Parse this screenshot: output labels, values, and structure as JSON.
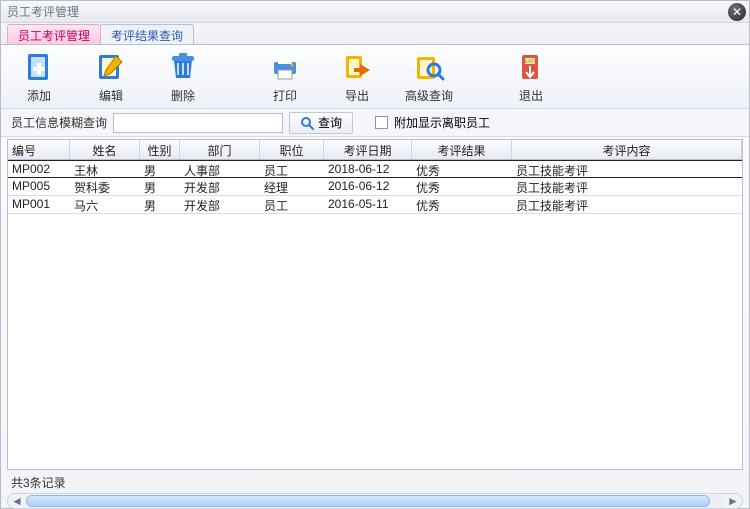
{
  "window": {
    "title": "员工考评管理"
  },
  "tabs": [
    {
      "label": "员工考评管理",
      "active": true
    },
    {
      "label": "考评结果查询",
      "active": false
    }
  ],
  "toolbar": {
    "add": "添加",
    "edit": "编辑",
    "delete": "删除",
    "print": "打印",
    "export": "导出",
    "adv_query": "高级查询",
    "exit": "退出"
  },
  "search": {
    "label": "员工信息模糊查询",
    "value": "",
    "placeholder": "",
    "query_btn": "查询",
    "show_left": "附加显示离职员工",
    "show_left_checked": false
  },
  "columns": [
    "编号",
    "姓名",
    "性别",
    "部门",
    "职位",
    "考评日期",
    "考评结果",
    "考评内容"
  ],
  "rows": [
    {
      "id": "MP002",
      "name": "王林",
      "gender": "男",
      "dept": "人事部",
      "title": "员工",
      "date": "2018-06-12",
      "result": "优秀",
      "content": "员工技能考评",
      "selected": true
    },
    {
      "id": "MP005",
      "name": "贺科委",
      "gender": "男",
      "dept": "开发部",
      "title": "经理",
      "date": "2016-06-12",
      "result": "优秀",
      "content": "员工技能考评",
      "selected": false
    },
    {
      "id": "MP001",
      "name": "马六",
      "gender": "男",
      "dept": "开发部",
      "title": "员工",
      "date": "2016-05-11",
      "result": "优秀",
      "content": "员工技能考评",
      "selected": false
    }
  ],
  "footer": {
    "count_text": "共3条记录"
  }
}
